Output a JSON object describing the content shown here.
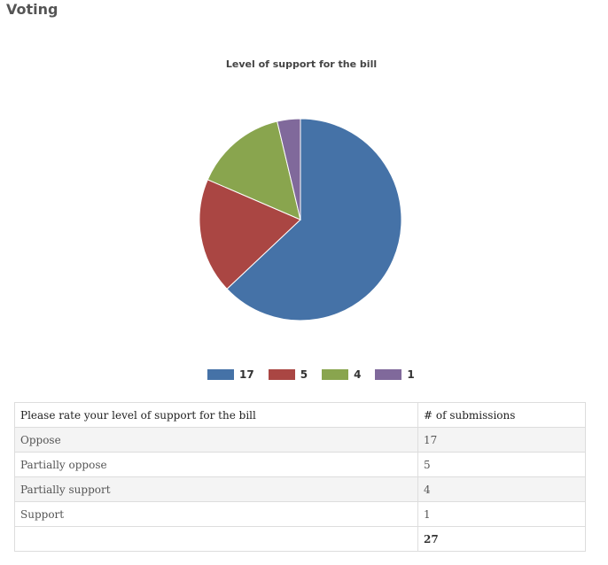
{
  "page": {
    "title": "Voting"
  },
  "chart_data": {
    "type": "pie",
    "title": "Level of support for the bill",
    "categories": [
      "Oppose",
      "Partially oppose",
      "Partially support",
      "Support"
    ],
    "values": [
      17,
      5,
      4,
      1
    ],
    "colors": [
      "#4572a7",
      "#aa4643",
      "#89a54e",
      "#80699b"
    ],
    "legend": {
      "labels": [
        "17",
        "5",
        "4",
        "1"
      ],
      "position": "bottom"
    },
    "start": "top-clockwise"
  },
  "table": {
    "headers": [
      "Please rate your level of support for the bill",
      "# of submissions"
    ],
    "rows": [
      [
        "Oppose",
        "17"
      ],
      [
        "Partially oppose",
        "5"
      ],
      [
        "Partially support",
        "4"
      ],
      [
        "Support",
        "1"
      ]
    ],
    "total": [
      "",
      "27"
    ]
  }
}
